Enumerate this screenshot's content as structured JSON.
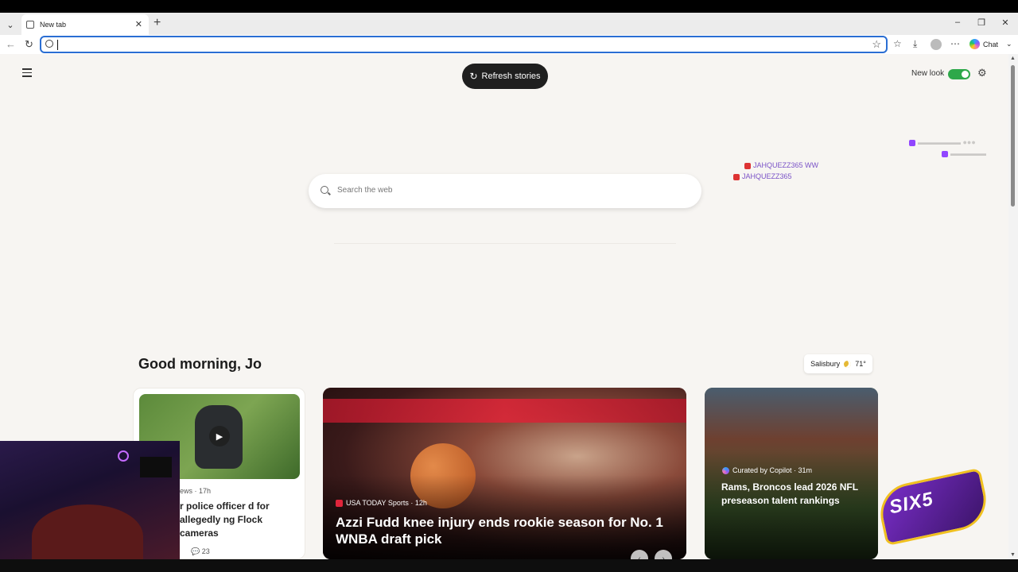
{
  "browser": {
    "tab_title": "New tab",
    "address_value": "",
    "chat_label": "Chat"
  },
  "page": {
    "refresh_label": "Refresh stories",
    "new_look_label": "New look",
    "search_placeholder": "Search the web",
    "greeting": "Good morning, Jo",
    "weather": {
      "location": "Salisbury",
      "temp": "71°"
    }
  },
  "overlay_chat": [
    {
      "user": "JAHQUEZZ365",
      "badge": "youtube"
    },
    {
      "user": "JAHQUEZZ365",
      "badge": "youtube"
    }
  ],
  "cards": {
    "small": {
      "source": "ews · 17h",
      "title": "r police officer d for allegedly ng Flock cameras",
      "comments": "23"
    },
    "big": {
      "source": "USA TODAY Sports · 12h",
      "title": "Azzi Fudd knee injury ends rookie season for No. 1 WNBA draft pick"
    },
    "right": {
      "source": "Curated by Copilot · 31m",
      "title": "Rams, Broncos lead 2026 NFL preseason talent rankings"
    }
  },
  "colors": {
    "accent": "#2a6ed3",
    "toggle_on": "#2ea84a",
    "refresh_bg": "#1f1f1f",
    "page_bg": "#f7f5f2"
  }
}
